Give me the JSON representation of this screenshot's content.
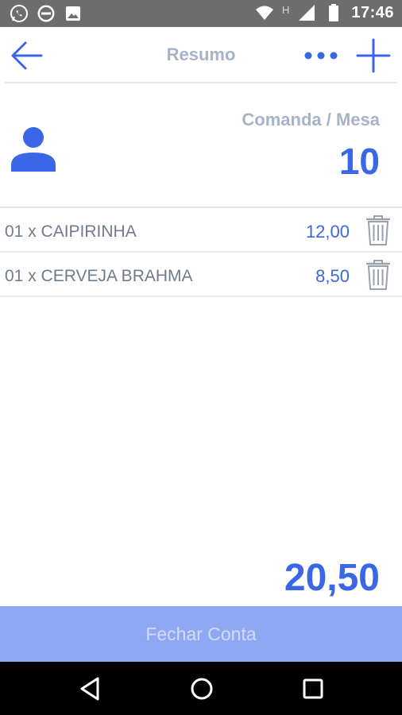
{
  "status_bar": {
    "time": "17:46",
    "icons": [
      "whatsapp-icon",
      "app-badge-icon",
      "image-icon",
      "wifi-icon",
      "h-signal-icon",
      "signal-icon",
      "battery-icon"
    ],
    "network_letter": "H"
  },
  "header": {
    "title": "Resumo",
    "back_icon": "arrow-left-icon",
    "more_icon": "more-dots-icon",
    "add_icon": "plus-icon"
  },
  "info": {
    "comanda_label": "Comanda / Mesa",
    "comanda_number": "10",
    "person_icon": "person-icon"
  },
  "items": [
    {
      "name": "01 x CAIPIRINHA",
      "price": "12,00",
      "icon": "trash-icon"
    },
    {
      "name": "01 x CERVEJA BRAHMA",
      "price": "8,50",
      "icon": "trash-icon"
    }
  ],
  "total": "20,50",
  "close_button": "Fechar Conta",
  "nav_bar": {
    "icons": [
      "back-triangle-icon",
      "home-circle-icon",
      "recents-square-icon"
    ]
  },
  "colors": {
    "accent": "#3b66e6",
    "muted_text": "#a7b3c8",
    "button_bg": "#8fa8f4",
    "status_bar": "#6d6d6d"
  }
}
